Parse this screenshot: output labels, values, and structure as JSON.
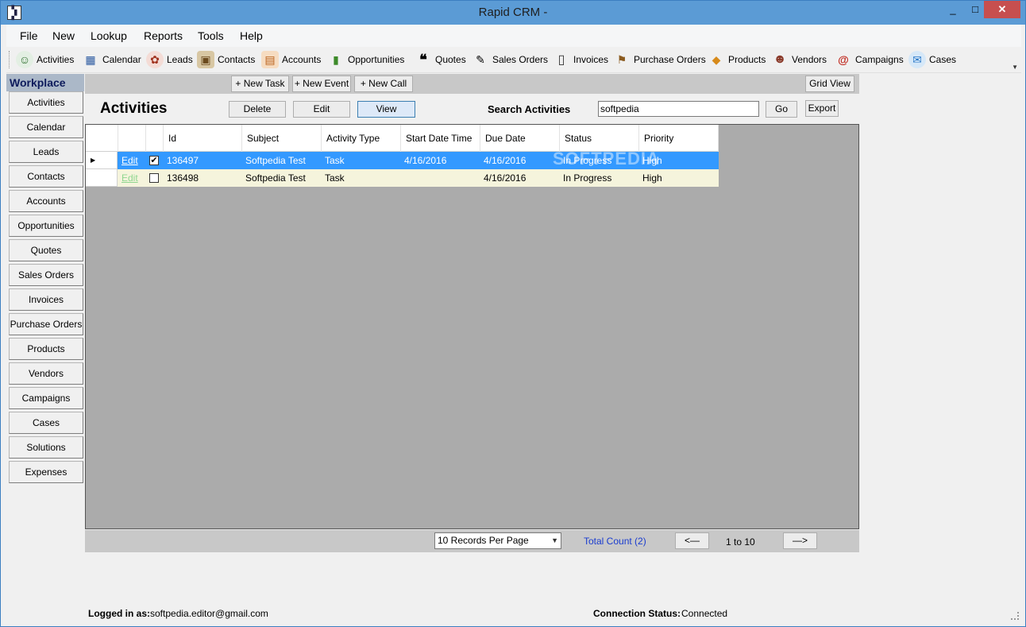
{
  "window": {
    "title": "Rapid CRM -",
    "minimize": "_",
    "maximize": "□",
    "close": "✕"
  },
  "menu": [
    "File",
    "New",
    "Lookup",
    "Reports",
    "Tools",
    "Help"
  ],
  "toolbar": [
    {
      "label": "Activities",
      "icon": "activities-icon",
      "glyph": "☺"
    },
    {
      "label": "Calendar",
      "icon": "calendar-icon",
      "glyph": "▦"
    },
    {
      "label": "Leads",
      "icon": "leads-icon",
      "glyph": "✿"
    },
    {
      "label": "Contacts",
      "icon": "contacts-icon",
      "glyph": "▣"
    },
    {
      "label": "Accounts",
      "icon": "accounts-icon",
      "glyph": "▤"
    },
    {
      "label": "Opportunities",
      "icon": "opportunities-icon",
      "glyph": "▮"
    },
    {
      "label": "Quotes",
      "icon": "quotes-icon",
      "glyph": "❝"
    },
    {
      "label": "Sales Orders",
      "icon": "sales-orders-icon",
      "glyph": "✎"
    },
    {
      "label": "Invoices",
      "icon": "invoices-icon",
      "glyph": "▯"
    },
    {
      "label": "Purchase Orders",
      "icon": "purchase-orders-icon",
      "glyph": "⚑"
    },
    {
      "label": "Products",
      "icon": "products-icon",
      "glyph": "◆"
    },
    {
      "label": "Vendors",
      "icon": "vendors-icon",
      "glyph": "☻"
    },
    {
      "label": "Campaigns",
      "icon": "campaigns-icon",
      "glyph": "@"
    },
    {
      "label": "Cases",
      "icon": "cases-icon",
      "glyph": "✉"
    }
  ],
  "sidebar": {
    "title": "Workplace",
    "items": [
      "Activities",
      "Calendar",
      "Leads",
      "Contacts",
      "Accounts",
      "Opportunities",
      "Quotes",
      "Sales Orders",
      "Invoices",
      "Purchase Orders",
      "Products",
      "Vendors",
      "Campaigns",
      "Cases",
      "Solutions",
      "Expenses"
    ]
  },
  "actions": {
    "new_task": "+ New Task",
    "new_event": "+ New Event",
    "new_call": "+ New Call",
    "grid_view": "Grid View",
    "delete": "Delete",
    "edit": "Edit",
    "view": "View",
    "go": "Go",
    "export": "Export"
  },
  "page": {
    "heading": "Activities",
    "search_label": "Search Activities",
    "search_value": "softpedia"
  },
  "grid": {
    "columns": [
      "Id",
      "Subject",
      "Activity Type",
      "Start Date Time",
      "Due Date",
      "Status",
      "Priority"
    ],
    "rows": [
      {
        "edit": "Edit",
        "checked": true,
        "id": "136497",
        "subject": "Softpedia Test",
        "type": "Task",
        "start": "4/16/2016",
        "due": "4/16/2016",
        "status": "In Progress",
        "priority": "High",
        "selected": true
      },
      {
        "edit": "Edit",
        "checked": false,
        "id": "136498",
        "subject": "Softpedia Test",
        "type": "Task",
        "start": "",
        "due": "4/16/2016",
        "status": "In Progress",
        "priority": "High",
        "selected": false
      }
    ],
    "watermark": "SOFTPEDIA"
  },
  "pager": {
    "per_page": "10 Records Per Page",
    "total": "Total Count (2)",
    "prev": "<—",
    "range": "1 to 10",
    "next": "—>"
  },
  "status": {
    "logged_label": "Logged in as:",
    "logged_value": "softpedia.editor@gmail.com",
    "conn_label": "Connection Status:",
    "conn_value": "Connected"
  },
  "colors": {
    "titlebar": "#5b9bd5",
    "selected_row": "#3399ff",
    "alt_row": "#f5f4dc",
    "grid_bg": "#ababab"
  }
}
